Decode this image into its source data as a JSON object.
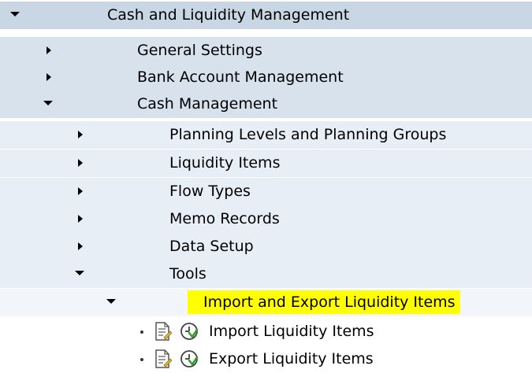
{
  "tree": {
    "root": "Cash and Liquidity Management",
    "general_settings": "General Settings",
    "bank_account_mgmt": "Bank Account Management",
    "cash_management": "Cash Management",
    "planning_levels": "Planning Levels and Planning Groups",
    "liquidity_items": "Liquidity Items",
    "flow_types": "Flow Types",
    "memo_records": "Memo Records",
    "data_setup": "Data Setup",
    "tools": "Tools",
    "import_export": "Import and Export Liquidity Items",
    "import_items": "Import Liquidity Items",
    "export_items": "Export Liquidity Items"
  },
  "colors": {
    "highlight": "#ffff00",
    "level0_bg": "#c9d6e3",
    "level1_bg": "#d7e2ec",
    "level2_bg": "#e8eef5"
  },
  "icons": {
    "expanded": "triangle-down-icon",
    "collapsed": "triangle-right-icon",
    "document": "document-edit-icon",
    "execute": "clock-execute-icon"
  }
}
